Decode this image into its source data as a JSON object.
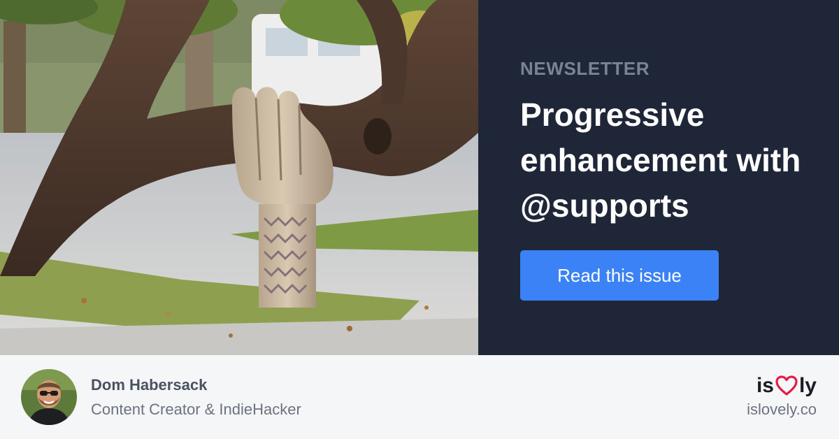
{
  "photo": {
    "alt_icon": "tree-hand-sculpture-photo"
  },
  "panel": {
    "eyebrow": "NEWSLETTER",
    "headline": "Progressive enhancement with @supports",
    "cta_label": "Read this issue"
  },
  "author": {
    "name": "Dom Habersack",
    "role": "Content Creator & IndieHacker"
  },
  "brand": {
    "logo_prefix": "is",
    "logo_suffix": "ly",
    "logo_icon": "heart-icon",
    "url": "islovely.co"
  },
  "colors": {
    "panel_bg": "#1f2637",
    "eyebrow": "#7a8396",
    "accent": "#3b82f6",
    "heart": "#e11d48",
    "footer_bg": "#f5f6f8"
  }
}
